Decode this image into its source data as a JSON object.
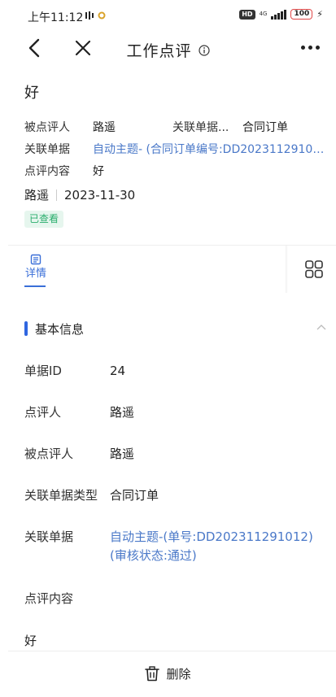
{
  "status_bar": {
    "time": "上午11:12",
    "hd": "HD",
    "network": "4G",
    "battery": "100"
  },
  "nav": {
    "title": "工作点评"
  },
  "summary": {
    "title": "好",
    "reviewee_label": "被点评人",
    "reviewee_value": "路遥",
    "rel_type_label": "关联单据...",
    "rel_type_value": "合同订单",
    "rel_doc_label": "关联单据",
    "rel_doc_value": "自动主题- (合同订单编号:DD20231129101...",
    "content_label": "点评内容",
    "content_value": "好",
    "author": "路遥",
    "date": "2023-11-30",
    "badge": "已查看"
  },
  "tabs": {
    "detail_label": "详情"
  },
  "section": {
    "title": "基本信息",
    "fields": [
      {
        "label": "单据ID",
        "value": "24"
      },
      {
        "label": "点评人",
        "value": "路遥"
      },
      {
        "label": "被点评人",
        "value": "路遥"
      },
      {
        "label": "关联单据类型",
        "value": "合同订单"
      },
      {
        "label": "关联单据",
        "value": "自动主题-(单号:DD202311291012)(审核状态:通过)"
      },
      {
        "label": "点评内容",
        "value": ""
      },
      {
        "label": "",
        "value": "好"
      }
    ]
  },
  "bottom": {
    "delete_label": "删除"
  },
  "colors": {
    "accent": "#3a6fd8",
    "link": "#4a78c8",
    "badge_text": "#2bae6d",
    "badge_bg": "#e6f6ee"
  }
}
